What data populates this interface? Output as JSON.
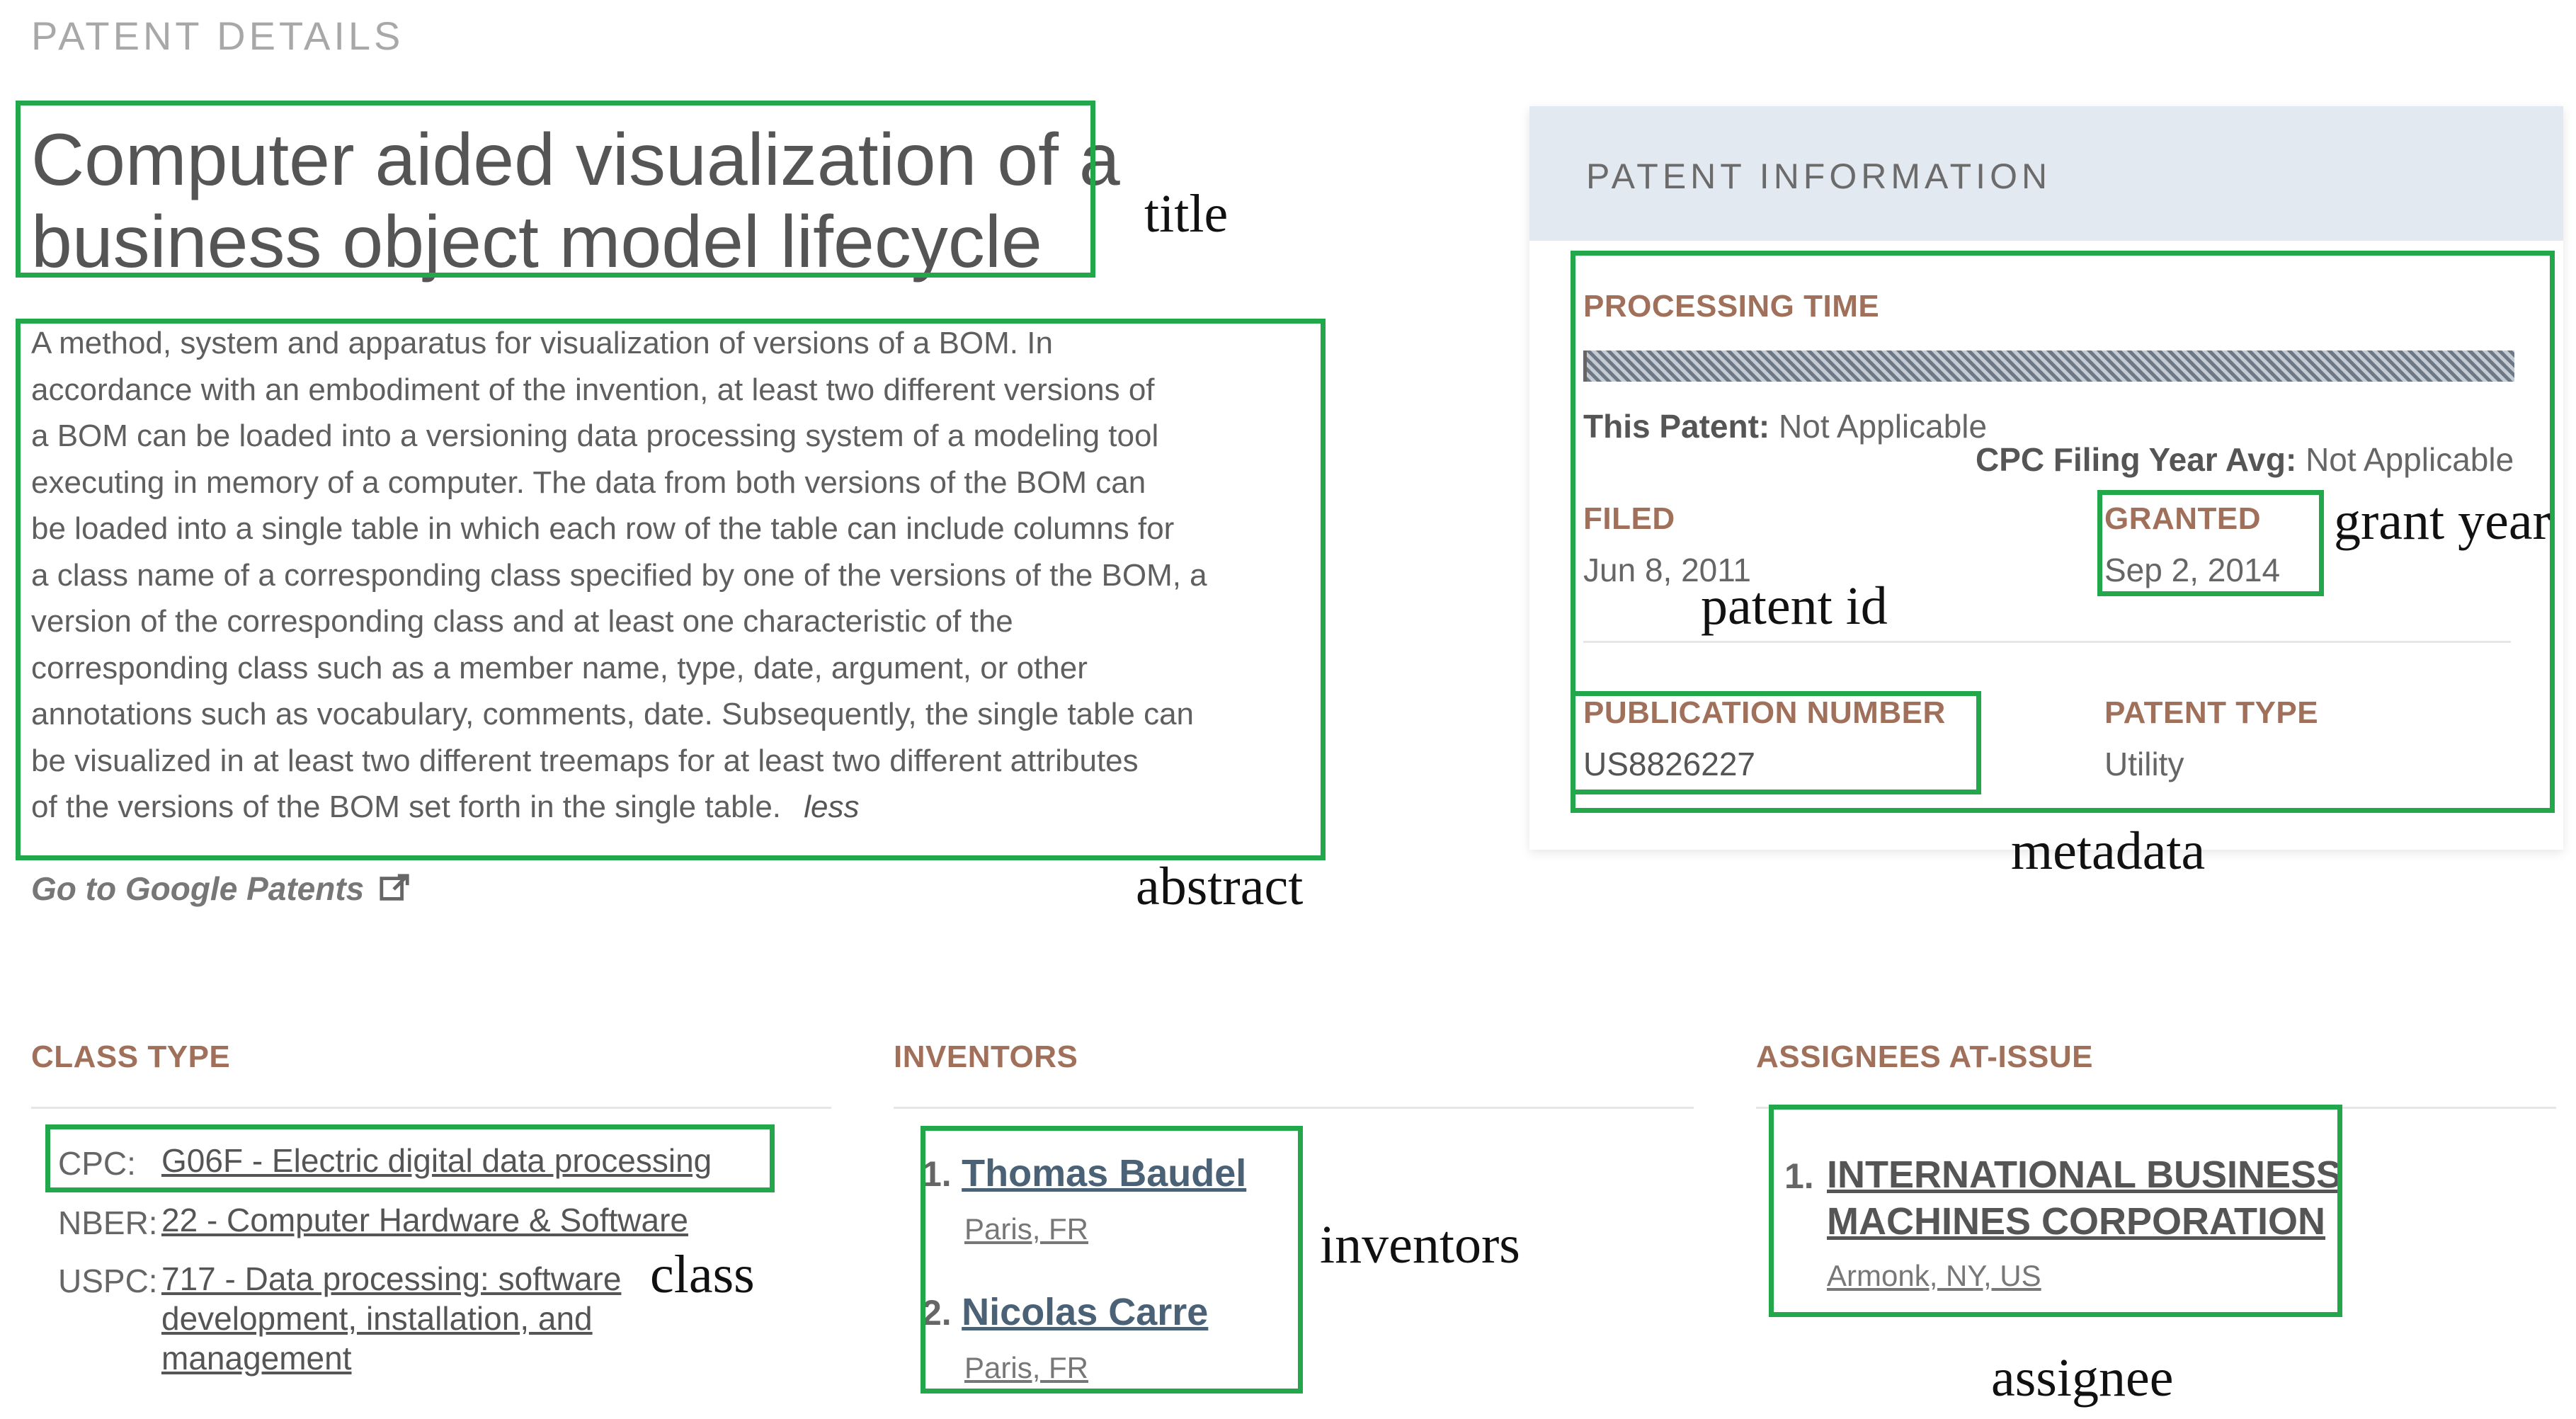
{
  "page": {
    "section_title": "PATENT DETAILS",
    "title_line1": "Computer aided visualization of a",
    "title_line2": "business object model lifecycle",
    "abstract_lines": [
      "A method, system and apparatus for visualization of versions of a BOM. In",
      "accordance with an embodiment of the invention, at least two different versions of",
      "a BOM can be loaded into a versioning data processing system of a modeling tool",
      "executing in memory of a computer. The data from both versions of the BOM can",
      "be loaded into a single table in which each row of the table can include columns for",
      "a class name of a corresponding class specified by one of the versions of the BOM, a",
      "version of the corresponding class and at least one characteristic of the",
      "corresponding class such as a member name, type, date, argument, or other",
      "annotations such as vocabulary, comments, date. Subsequently, the single table can",
      "be visualized in at least two different treemaps for at least two different attributes",
      "of the versions of the BOM set forth in the single table."
    ],
    "less_label": "less",
    "google_link": "Go to Google Patents",
    "external_icon": "external-link-icon"
  },
  "info": {
    "header": "PATENT INFORMATION",
    "processing_time_label": "PROCESSING TIME",
    "this_patent_label": "This Patent:",
    "this_patent_value": "Not Applicable",
    "cpc_avg_label": "CPC Filing Year Avg:",
    "cpc_avg_value": "Not Applicable",
    "filed_label": "FILED",
    "filed_value": "Jun 8, 2011",
    "granted_label": "GRANTED",
    "granted_value": "Sep 2, 2014",
    "publication_label": "PUBLICATION NUMBER",
    "publication_value": "US8826227",
    "patent_type_label": "PATENT TYPE",
    "patent_type_value": "Utility"
  },
  "class_type": {
    "header": "CLASS TYPE",
    "cpc_label": "CPC:",
    "cpc_value": "G06F - Electric digital data processing",
    "nber_label": "NBER:",
    "nber_value": "22 - Computer Hardware & Software",
    "uspc_label": "USPC:",
    "uspc_lines": [
      "717 - Data processing: software",
      "development, installation, and",
      "management"
    ]
  },
  "inventors": {
    "header": "INVENTORS",
    "items": [
      {
        "num": "1.",
        "name": "Thomas Baudel",
        "location": "Paris, FR"
      },
      {
        "num": "2.",
        "name": "Nicolas Carre",
        "location": "Paris, FR"
      }
    ]
  },
  "assignees": {
    "header": "ASSIGNEES AT-ISSUE",
    "num": "1.",
    "name_line1": "INTERNATIONAL BUSINESS",
    "name_line2": "MACHINES CORPORATION",
    "location": "Armonk, NY, US"
  },
  "annotations": {
    "title": "title",
    "abstract": "abstract",
    "metadata": "metadata",
    "grant_year": "grant year",
    "patent_id": "patent id",
    "class": "class",
    "inventors": "inventors",
    "assignee": "assignee"
  },
  "colors": {
    "annotation_box": "#22a84a",
    "label_brown": "#a0705a",
    "info_header_bg": "#e3e9f1"
  }
}
